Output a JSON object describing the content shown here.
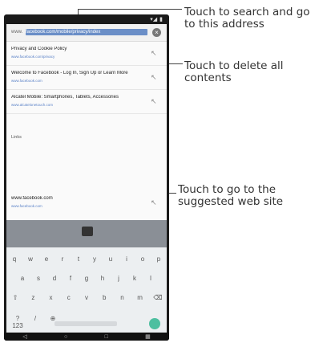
{
  "callouts": {
    "search": "Touch to search and go\nto this address",
    "delete": "Touch to delete all\ncontents",
    "suggested": "Touch to go to the\nsuggested web site"
  },
  "status_bar": {
    "signal": "▾◢",
    "battery": "▮"
  },
  "browser": {
    "url_prefix": "www.",
    "url_text": "facebook.com/mobile/privacy/index",
    "suggestions": [
      {
        "title": "Privacy and Cookie Policy",
        "url": "www.facebook.com/privacy"
      },
      {
        "title": "Welcome to Facebook - Log In, Sign Up or Learn More",
        "url": "www.facebook.com"
      },
      {
        "title": "Alcatel Mobile: Smartphones, Tablets, Accessories",
        "url": "www.alcatelonetouch.com"
      }
    ],
    "section_label": "Links",
    "suggested_site": {
      "title": "www.facebook.com",
      "url": "www.facebook.com"
    }
  },
  "keyboard": {
    "row1": [
      "q",
      "w",
      "e",
      "r",
      "t",
      "y",
      "u",
      "i",
      "o",
      "p"
    ],
    "row2": [
      "a",
      "s",
      "d",
      "f",
      "g",
      "h",
      "j",
      "k",
      "l"
    ],
    "row3": [
      "⇧",
      "z",
      "x",
      "c",
      "v",
      "b",
      "n",
      "m",
      "⌫"
    ],
    "row4": [
      "?123",
      "/",
      "⊕"
    ]
  },
  "navbar": {
    "back": "◁",
    "home": "○",
    "recent": "□",
    "keyboard": "▦"
  }
}
